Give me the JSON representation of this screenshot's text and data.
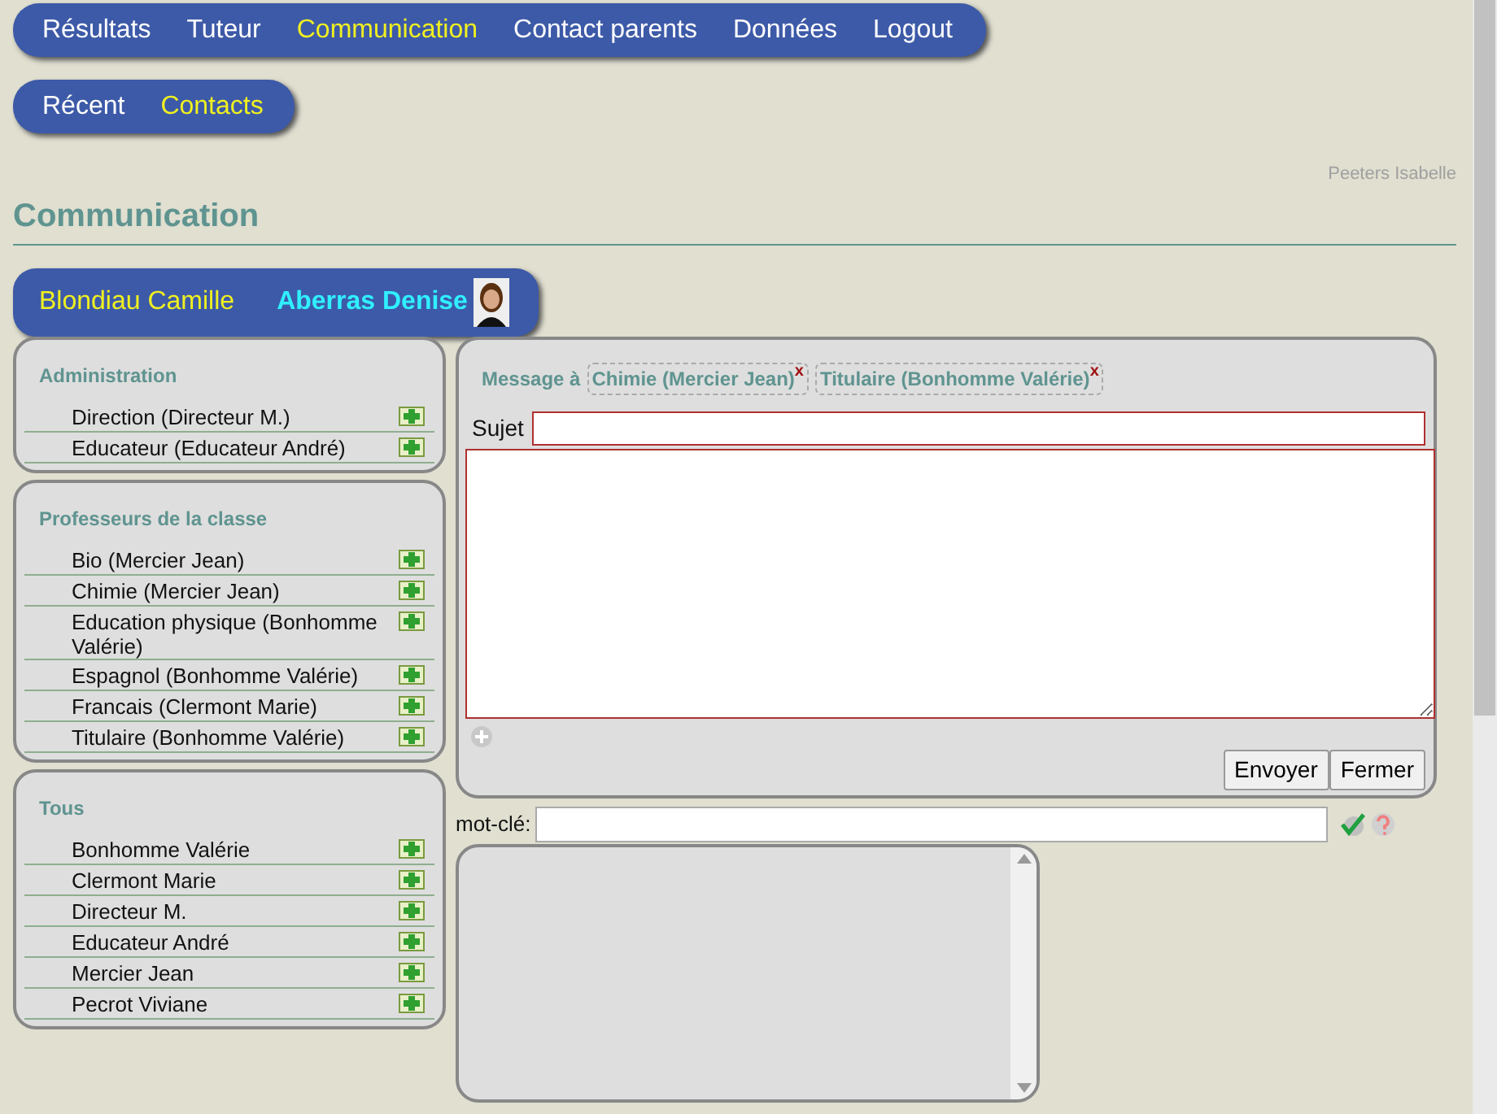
{
  "nav": [
    {
      "label": "Résultats",
      "selected": false
    },
    {
      "label": "Tuteur",
      "selected": false
    },
    {
      "label": "Communication",
      "selected": true
    },
    {
      "label": "Contact parents",
      "selected": false
    },
    {
      "label": "Données",
      "selected": false
    },
    {
      "label": "Logout",
      "selected": false
    }
  ],
  "subnav": [
    {
      "label": "Récent",
      "selected": false
    },
    {
      "label": "Contacts",
      "selected": true
    }
  ],
  "user": "Peeters Isabelle",
  "heading": "Communication",
  "students": [
    {
      "name": "Blondiau Camille",
      "selected": false
    },
    {
      "name": "Aberras Denise",
      "selected": true
    }
  ],
  "groups": [
    {
      "title": "Administration",
      "contacts": [
        "Direction (Directeur M.)",
        "Educateur (Educateur André)"
      ]
    },
    {
      "title": "Professeurs de la classe",
      "contacts": [
        "Bio (Mercier Jean)",
        "Chimie (Mercier Jean)",
        "Education physique (Bonhomme Valérie)",
        "Espagnol (Bonhomme Valérie)",
        "Francais (Clermont Marie)",
        "Titulaire (Bonhomme Valérie)"
      ]
    },
    {
      "title": "Tous",
      "contacts": [
        "Bonhomme Valérie",
        "Clermont Marie",
        "Directeur M.",
        "Educateur André",
        "Mercier Jean",
        "Pecrot Viviane"
      ]
    }
  ],
  "message": {
    "label": "Message à",
    "recipients": [
      {
        "name": "Chimie (Mercier Jean)",
        "remove": "x"
      },
      {
        "name": "Titulaire (Bonhomme Valérie)",
        "remove": "x"
      }
    ],
    "subject_label": "Sujet",
    "buttons": [
      "Envoyer",
      "Fermer"
    ]
  },
  "search": {
    "label": "mot-clé:"
  }
}
